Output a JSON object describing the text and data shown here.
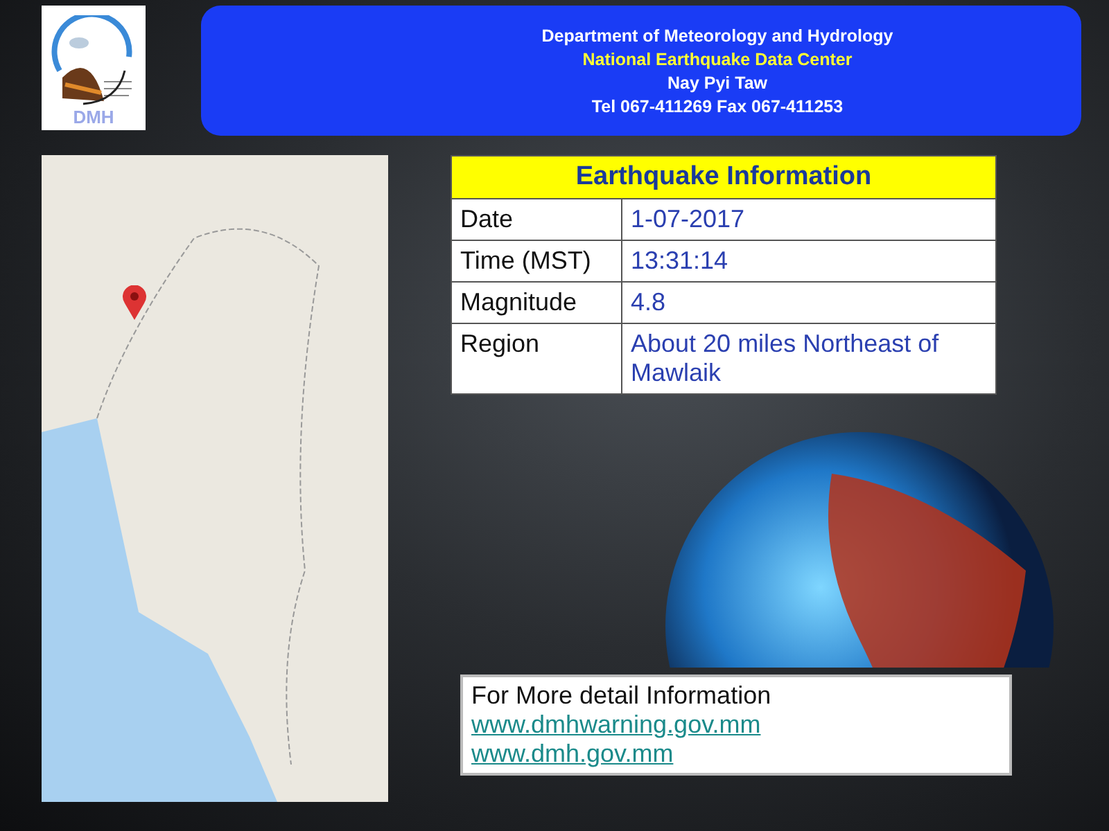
{
  "header": {
    "logo_text": "DMH",
    "lines": [
      {
        "text": "Department of Meteorology and Hydrology",
        "kind": "title"
      },
      {
        "text": "National Earthquake Data Center",
        "kind": "highlight"
      },
      {
        "text": "Nay Pyi Taw",
        "kind": "plain"
      },
      {
        "text": "Tel 067-411269 Fax 067-411253",
        "kind": "plain"
      }
    ]
  },
  "info_table": {
    "title": "Earthquake Information",
    "rows": [
      {
        "label": "Date",
        "value": "1-07-2017"
      },
      {
        "label": "Time (MST)",
        "value": "13:31:14"
      },
      {
        "label": "Magnitude",
        "value": "4.8"
      },
      {
        "label": "Region",
        "value": "About 20 miles Northeast of Mawlaik"
      }
    ]
  },
  "more_info": {
    "heading": "For More detail Information",
    "links": [
      "www.dmhwarning.gov.mm",
      "www.dmh.gov.mm"
    ]
  }
}
